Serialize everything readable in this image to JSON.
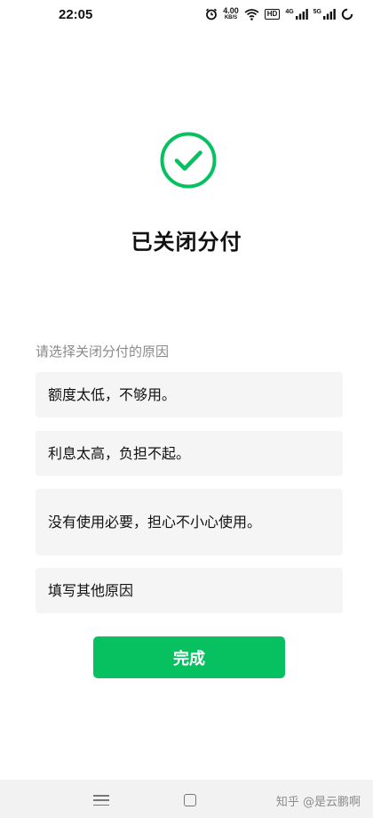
{
  "status_bar": {
    "time": "22:05",
    "speed_value": "4.00",
    "speed_unit": "KB/S",
    "hd_label": "HD",
    "network1": "4G",
    "network2": "5G",
    "icons": [
      "alarm-icon",
      "wifi-icon",
      "signal-icon",
      "signal-icon",
      "battery-icon"
    ]
  },
  "main": {
    "title": "已关闭分付",
    "section_label": "请选择关闭分付的原因",
    "options": [
      "额度太低，不够用。",
      "利息太高，负担不起。",
      "没有使用必要，担心不小心使用。",
      "填写其他原因"
    ],
    "done_label": "完成"
  },
  "watermark": "知乎 @是云鹏啊",
  "colors": {
    "accent": "#07c160",
    "option_bg": "#f5f5f5",
    "label_gray": "#8a8a8a"
  }
}
